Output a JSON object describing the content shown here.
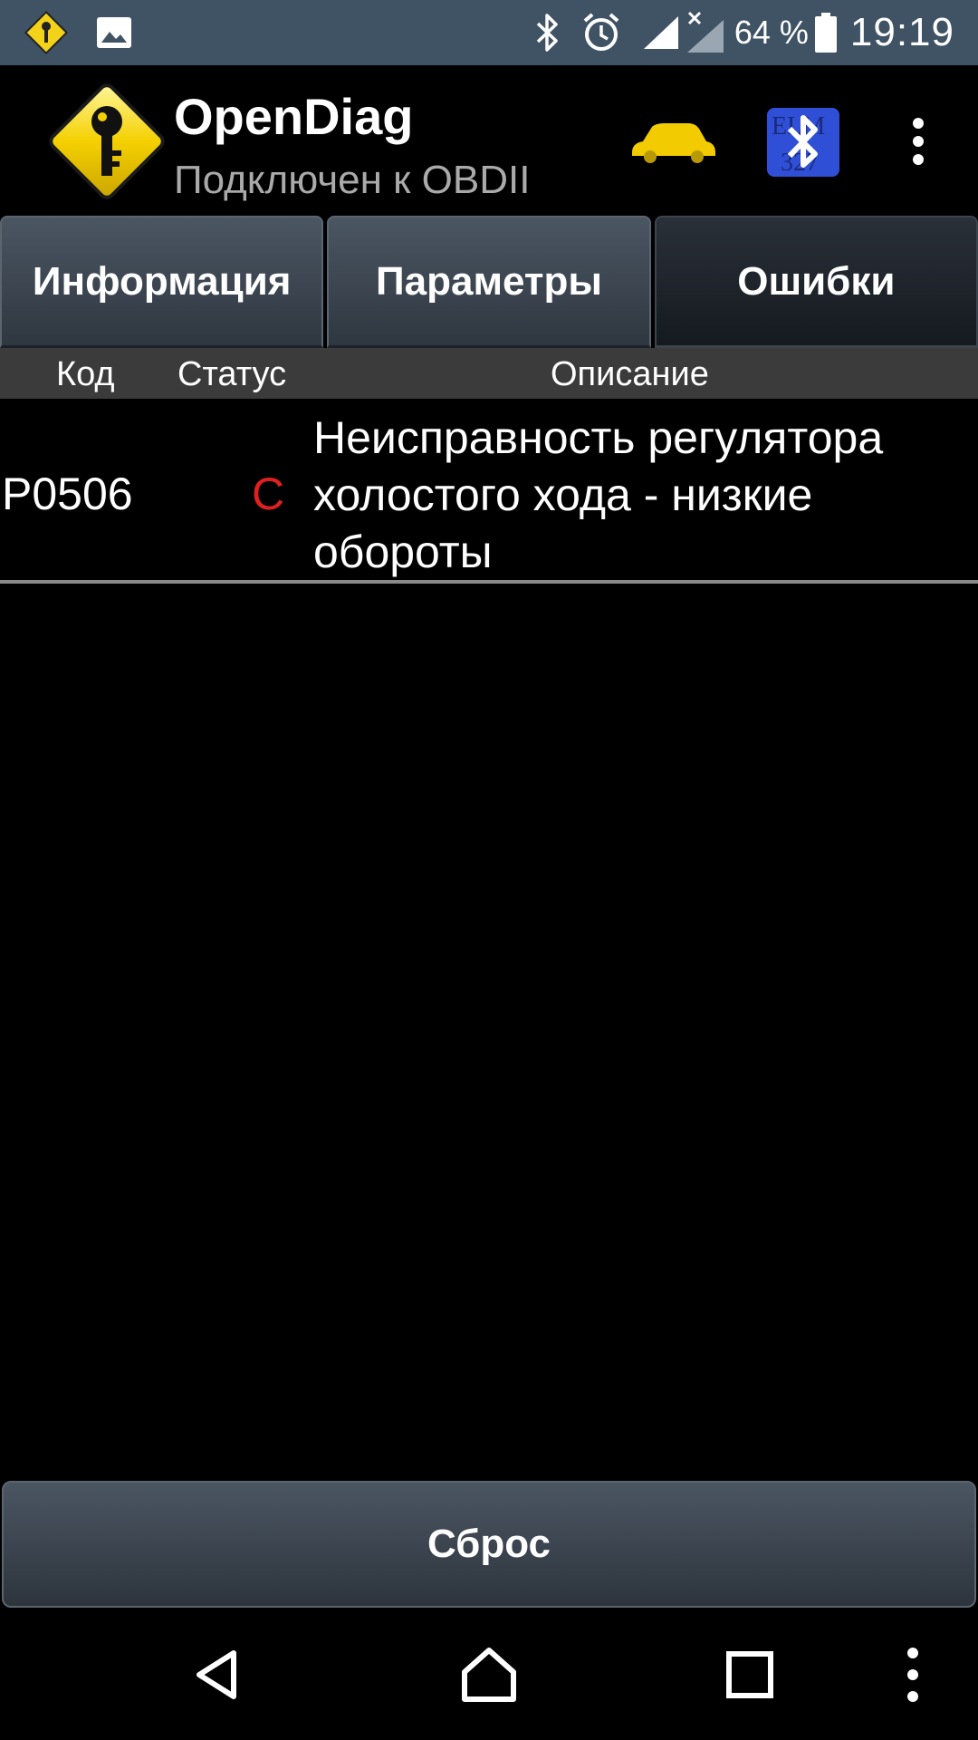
{
  "status_bar": {
    "battery_percent": "64 %",
    "time": "19:19",
    "icons": [
      "opendiag-notification-icon",
      "image-notification-icon",
      "bluetooth-icon",
      "alarm-icon",
      "signal-icon",
      "signal-no-sim-icon",
      "battery-icon"
    ]
  },
  "app_bar": {
    "title": "OpenDiag",
    "subtitle": "Подключен к OBDII",
    "icons": [
      "opendiag-logo-icon",
      "car-icon",
      "bluetooth-elm327-icon",
      "overflow-menu-icon"
    ],
    "colors": {
      "car": "#f2cc00",
      "bluetooth_badge": "#2f4fd6"
    }
  },
  "tabs": [
    {
      "label": "Информация",
      "active": false
    },
    {
      "label": "Параметры",
      "active": false
    },
    {
      "label": "Ошибки",
      "active": true
    }
  ],
  "table": {
    "columns": [
      "Код",
      "Статус",
      "Описание"
    ],
    "rows": [
      {
        "code": "P0506",
        "status": "C",
        "description": "Неисправность регулятора холостого хода - низкие обороты"
      }
    ]
  },
  "reset_button": {
    "label": "Сброс"
  },
  "colors": {
    "status_bar_bg": "#3f5365",
    "status_error": "#e02020",
    "header_bg": "#3b3b3b"
  },
  "nav_bar": {
    "icons": [
      "back-icon",
      "home-icon",
      "recents-icon",
      "nav-overflow-icon"
    ]
  }
}
